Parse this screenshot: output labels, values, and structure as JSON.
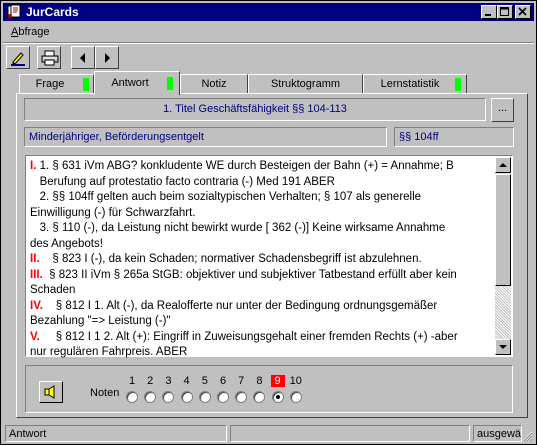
{
  "window": {
    "title": "JurCards"
  },
  "menu": {
    "items": [
      {
        "label": "Abfrage",
        "mnemonic": "A",
        "rest": "bfrage"
      }
    ]
  },
  "toolbar": {
    "buttons": [
      {
        "icon": "pen-edit-icon"
      },
      {
        "icon": "printer-icon"
      },
      {
        "icon": "arrow-left-icon"
      },
      {
        "icon": "arrow-right-icon"
      }
    ]
  },
  "tabs": [
    {
      "label": "Frage",
      "indicator": true
    },
    {
      "label": "Antwort",
      "indicator": true,
      "active": true
    },
    {
      "label": "Notiz",
      "indicator": false
    },
    {
      "label": "Struktogramm",
      "indicator": false
    },
    {
      "label": "Lernstatistik",
      "indicator": true
    }
  ],
  "fields": {
    "chapter": "1. Titel Geschäftsfähigkeit §§ 104-113",
    "more_button": "...",
    "topic": "Minderjähriger, Beförderungsentgelt",
    "reference": "§§ 104ff"
  },
  "answer": {
    "lines": [
      {
        "num": "I.",
        "text": "1. § 631 iVm ABG? konkludente WE durch Besteigen der Bahn (+) = Annahme; B"
      },
      {
        "num": "",
        "text": "   Berufung auf protestatio facto contraria (-) Med 191 ABER"
      },
      {
        "num": "",
        "text": "   2. §§ 104ff gelten auch beim sozialtypischen Verhalten; § 107 als generelle"
      },
      {
        "num": "",
        "text": "Einwilligung (-) für Schwarzfahrt."
      },
      {
        "num": "",
        "text": "   3. § 110 (-), da Leistung nicht bewirkt wurde [ 362 (-)] Keine wirksame Annahme"
      },
      {
        "num": "",
        "text": "des Angebots!"
      },
      {
        "num": "II.",
        "text": "   § 823 I (-), da kein Schaden; normativer Schadensbegriff ist abzulehnen."
      },
      {
        "num": "III.",
        "text": " § 823 II iVm § 265a StGB: objektiver und subjektiver Tatbestand erfüllt aber kein"
      },
      {
        "num": "",
        "text": "Schaden"
      },
      {
        "num": "IV.",
        "text": "   § 812 I 1. Alt (-), da Realofferte nur unter der Bedingung ordnungsgemäßer"
      },
      {
        "num": "",
        "text": "Bezahlung \"=> Leistung (-)\""
      },
      {
        "num": "V.",
        "text": "    § 812 I 1 2. Alt (+): Eingriff in Zuweisungsgehalt einer fremden Rechts (+) -aber"
      },
      {
        "num": "",
        "text": "nur regulären Fahrpreis. ABER"
      }
    ]
  },
  "rating": {
    "label": "Noten",
    "numbers": [
      "1",
      "2",
      "3",
      "4",
      "5",
      "6",
      "7",
      "8",
      "9",
      "10"
    ],
    "highlighted": "9",
    "selected_index": 8
  },
  "status": {
    "left": "Antwort",
    "middle": "",
    "right": "ausgewäl"
  },
  "colors": {
    "titlebar": "#000080",
    "field_text": "#000080",
    "roman_numeral": "#ff0000",
    "tab_indicator": "#00ff00",
    "highlight": "#ff0000"
  }
}
